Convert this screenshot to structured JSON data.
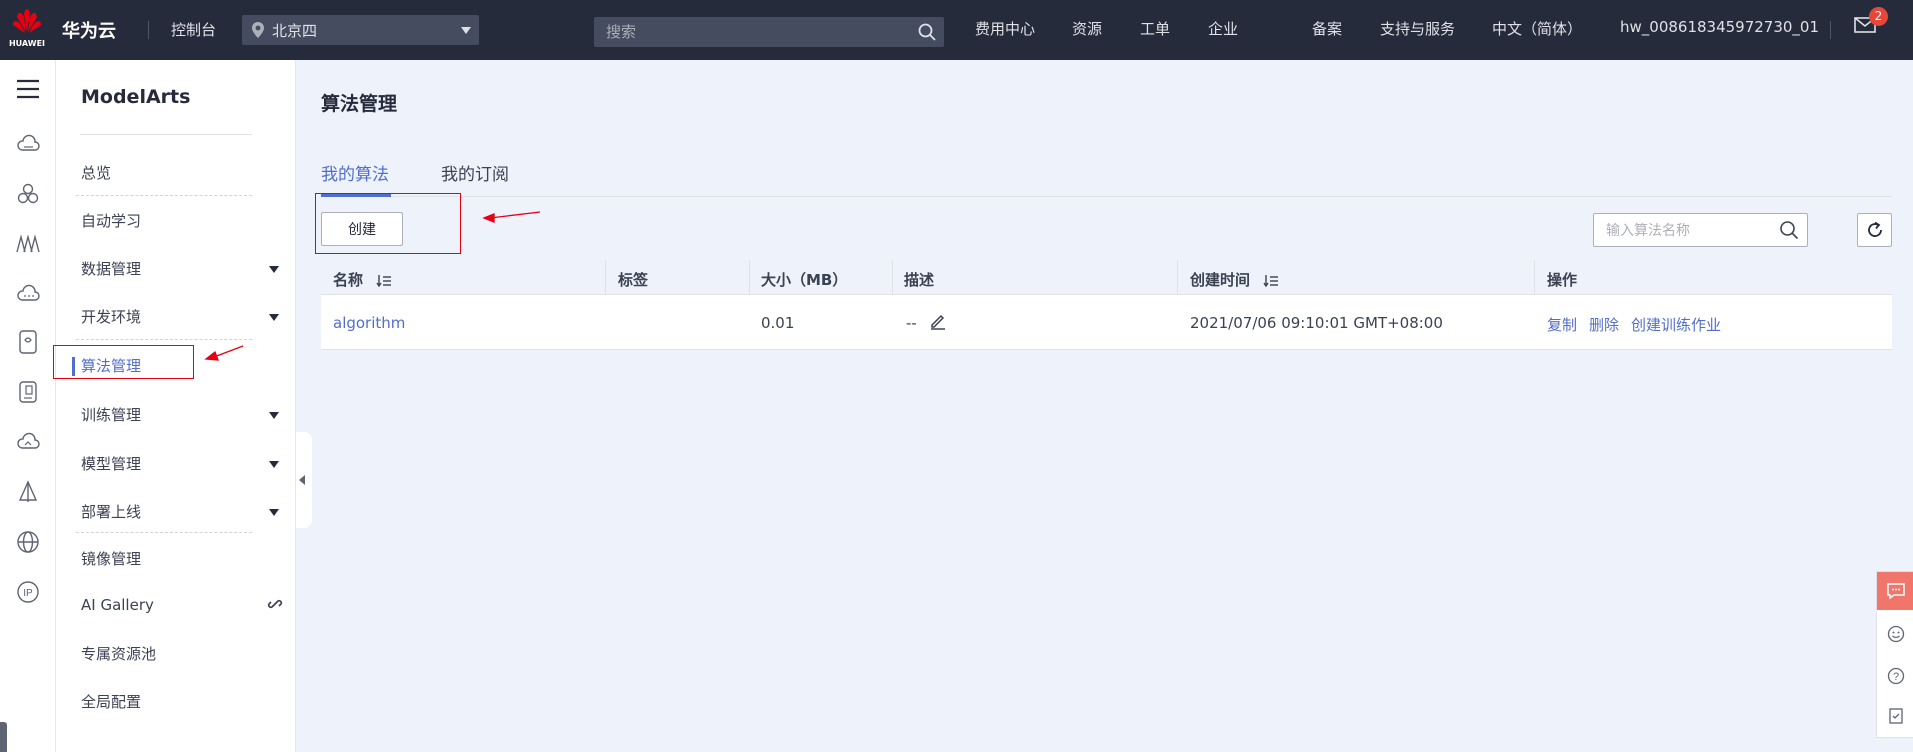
{
  "topbar": {
    "logo_text": "HUAWEI",
    "brand": "华为云",
    "console": "控制台",
    "region": "北京四",
    "search_placeholder": "搜索",
    "nav": [
      "费用中心",
      "资源",
      "工单",
      "企业",
      "备案",
      "支持与服务",
      "中文（简体）",
      "hw_008618345972730_01"
    ],
    "mail_badge": "2"
  },
  "rail_icons": [
    "hamburger-icon",
    "cloud-server-icon",
    "cluster-icon",
    "network-icon",
    "cloud-storage-icon",
    "database-icon",
    "document-icon",
    "cloud-upload-icon",
    "ai-platform-icon",
    "globe-icon",
    "ip-icon"
  ],
  "menu": {
    "title": "ModelArts",
    "items": [
      {
        "label": "总览"
      },
      {
        "label": "自动学习"
      },
      {
        "label": "数据管理"
      },
      {
        "label": "开发环境"
      },
      {
        "label": "算法管理"
      },
      {
        "label": "训练管理"
      },
      {
        "label": "模型管理"
      },
      {
        "label": "部署上线"
      },
      {
        "label": "镜像管理"
      },
      {
        "label": "AI Gallery"
      },
      {
        "label": "专属资源池"
      },
      {
        "label": "全局配置"
      }
    ]
  },
  "main": {
    "title": "算法管理",
    "tabs": [
      "我的算法",
      "我的订阅"
    ],
    "create_label": "创建",
    "filter_placeholder": "输入算法名称",
    "columns": [
      "名称",
      "标签",
      "大小（MB）",
      "描述",
      "创建时间",
      "操作"
    ],
    "rows": [
      {
        "name": "algorithm",
        "tag": "",
        "size": "0.01",
        "desc": "--",
        "created": "2021/07/06 09:10:01 GMT+08:00",
        "ops": [
          "复制",
          "删除",
          "创建训练作业"
        ]
      }
    ]
  },
  "colors": {
    "topbar": "#252b3a",
    "accent": "#526ecc",
    "annotation": "#e60012",
    "page_bg": "#eef2fb"
  }
}
